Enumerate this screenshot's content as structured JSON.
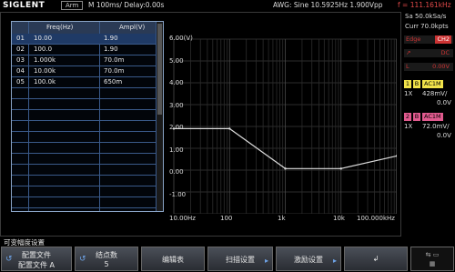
{
  "topbar": {
    "brand": "SIGLENT",
    "run_state": "Arm",
    "timebase": "M 100ms/ Delay:0.00s",
    "awg_info": "AWG: Sine  10.5925Hz  1.900Vpp",
    "freq_readout": "f = 111.161kHz"
  },
  "table": {
    "columns": [
      "Freq(Hz)",
      "Ampl(V)"
    ],
    "rows": [
      {
        "index": "01",
        "freq": "10.00",
        "ampl": "1.90"
      },
      {
        "index": "02",
        "freq": "100.0",
        "ampl": "1.90"
      },
      {
        "index": "03",
        "freq": "1.000k",
        "ampl": "70.0m"
      },
      {
        "index": "04",
        "freq": "10.00k",
        "ampl": "70.0m"
      },
      {
        "index": "05",
        "freq": "100.0k",
        "ampl": "650m"
      }
    ],
    "selected_row": 0
  },
  "plot": {
    "y_labels": [
      "6.00(V)",
      "5.00",
      "4.00",
      "3.00",
      "2.00",
      "1.00",
      "0.00",
      "-1.00"
    ],
    "x_labels": [
      "10.00Hz",
      "100",
      "1k",
      "10k",
      "100.000kHz"
    ]
  },
  "chart_data": {
    "type": "line",
    "x": [
      10,
      100,
      1000,
      10000,
      100000
    ],
    "values": [
      1.9,
      1.9,
      0.07,
      0.07,
      0.65
    ],
    "xscale": "log",
    "xlim": [
      10,
      100000
    ],
    "ylim": [
      -2.0,
      6.0
    ],
    "ylabel": "6.00(V)",
    "grid": true,
    "line_color": "#dcdcdc"
  },
  "right_panel": {
    "sa": "Sa 50.0kSa/s",
    "curr": "Curr 70.0kpts",
    "edge_label": "Edge",
    "edge_value": "CH2",
    "coupling_value": "DC",
    "level_label": "L",
    "level_value": "0.00V",
    "ch1": {
      "num": "1",
      "b": "B",
      "coupling": "AC1M",
      "probe": "1X",
      "scale": "428mV/",
      "offset": "0.0V",
      "color": "#f0e24a"
    },
    "ch2": {
      "num": "2",
      "b": "B",
      "coupling": "AC1M",
      "probe": "1X",
      "scale": "72.0mV/",
      "offset": "0.0V",
      "color": "#e05a8e"
    }
  },
  "menu": {
    "title": "可变幅度设置",
    "softkeys": [
      {
        "line1": "配置文件",
        "line2": "配置文件 A"
      },
      {
        "line1": "结点数",
        "line2": "5"
      },
      {
        "line1": "编辑表",
        "line2": ""
      },
      {
        "line1": "扫描设置",
        "line2": ""
      },
      {
        "line1": "激励设置",
        "line2": ""
      },
      {
        "line1": "",
        "line2": ""
      }
    ]
  },
  "colors": {
    "accent": "#6fa4e8",
    "warning": "#c33333"
  }
}
